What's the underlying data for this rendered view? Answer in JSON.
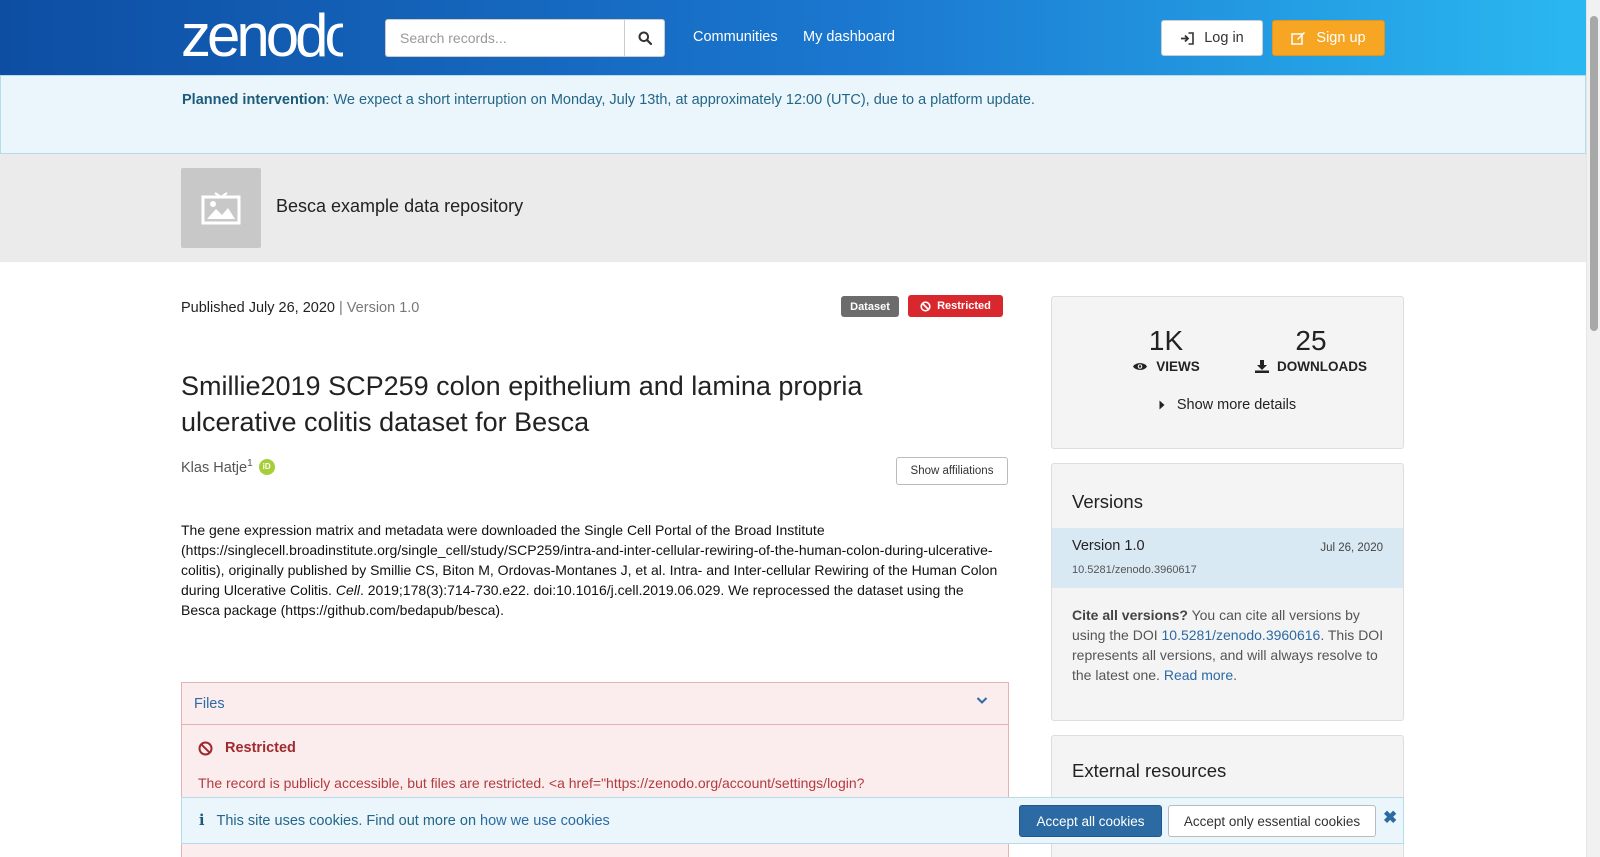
{
  "header": {
    "logo_text": "zenodo",
    "search_placeholder": "Search records...",
    "nav": [
      "Communities",
      "My dashboard"
    ],
    "login_label": "Log in",
    "signup_label": "Sign up"
  },
  "announcement": {
    "label": "Planned intervention",
    "text": ": We expect a short interruption on Monday, July 13th, at approximately 12:00 (UTC), due to a platform update."
  },
  "community": {
    "title": "Besca example data repository"
  },
  "record": {
    "published": "Published July 26, 2020",
    "version": "| Version 1.0",
    "badge_type": "Dataset",
    "badge_access": "Restricted",
    "title": "Smillie2019 SCP259 colon epithelium and lamina propria ulcerative colitis dataset for Besca",
    "creator": "Klas Hatje",
    "creator_affiliation_ref": "1",
    "orcid_label": "iD",
    "show_affiliations_label": "Show affiliations",
    "description_part1": "The gene expression matrix and metadata were downloaded the Single Cell Portal of the Broad Institute (https://singlecell.broadinstitute.org/single_cell/study/SCP259/intra-and-inter-cellular-rewiring-of-the-human-colon-during-ulcerative-colitis), originally published by Smillie CS, Biton M, Ordovas-Montanes J, et al. Intra- and Inter-cellular Rewiring of the Human Colon during Ulcerative Colitis. ",
    "description_journal": "Cell",
    "description_part2": ". 2019;178(3):714-730.e22. doi:10.1016/j.cell.2019.06.029. We reprocessed the dataset using the Besca package (https://github.com/bedapub/besca)."
  },
  "files": {
    "header": "Files",
    "restricted_title": "Restricted",
    "restricted_text": "The record is publicly accessible, but files are restricted. <a href=\"https://zenodo.org/account/settings/login?"
  },
  "stats": {
    "views_value": "1K",
    "views_label": "VIEWS",
    "downloads_value": "25",
    "downloads_label": "DOWNLOADS",
    "more_details_label": "Show more details"
  },
  "versions": {
    "title": "Versions",
    "items": [
      {
        "name": "Version 1.0",
        "date": "Jul 26, 2020",
        "doi": "10.5281/zenodo.3960617"
      }
    ],
    "cite_all_bold": "Cite all versions?",
    "cite_all_text1": " You can cite all versions by using the DOI ",
    "cite_all_doi": "10.5281/zenodo.3960616",
    "cite_all_text2": ". This DOI represents all versions, and will always resolve to the latest one. ",
    "read_more": "Read more",
    "period": "."
  },
  "external": {
    "title": "External resources"
  },
  "cookies": {
    "text": "This site uses cookies. Find out more on",
    "link": "how we use cookies",
    "accept_all": "Accept all cookies",
    "accept_essential": "Accept only essential cookies"
  },
  "colors": {
    "accent": "#2b6aa3",
    "signup": "#f6a623",
    "restricted": "#d9272e"
  }
}
